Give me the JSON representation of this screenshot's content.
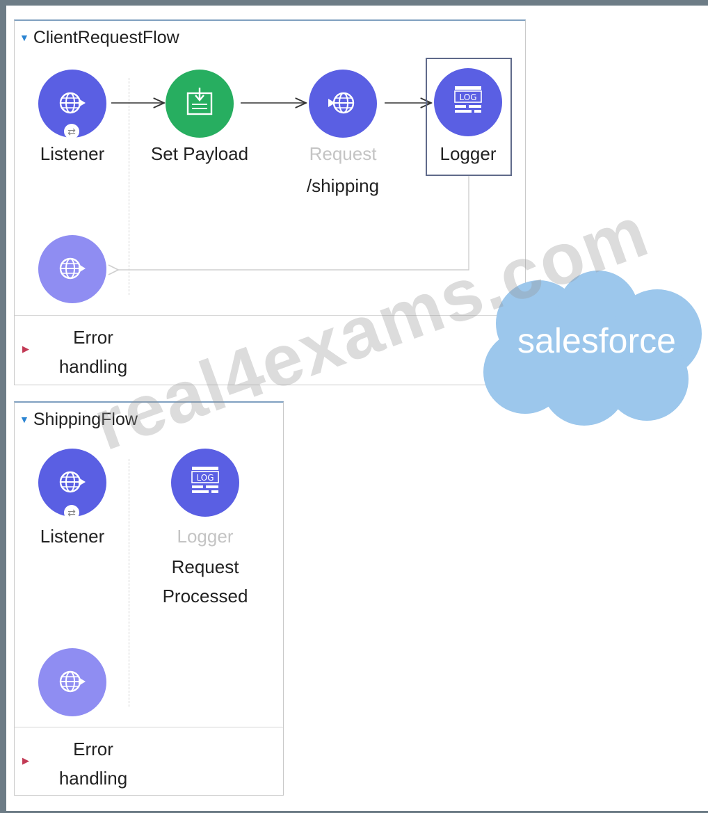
{
  "flows": [
    {
      "title": "ClientRequestFlow",
      "nodes": [
        {
          "label": "Listener",
          "icon": "globe-icon"
        },
        {
          "label": "Set Payload",
          "icon": "set-payload-icon"
        },
        {
          "label": "Request",
          "sublabel": "/shipping",
          "icon": "globe-icon"
        },
        {
          "label": "Logger",
          "icon": "log-icon"
        }
      ],
      "error_label_1": "Error",
      "error_label_2": "handling"
    },
    {
      "title": "ShippingFlow",
      "nodes": [
        {
          "label": "Listener",
          "icon": "globe-icon"
        },
        {
          "label": "Logger",
          "sublabel_1": "Request",
          "sublabel_2": "Processed",
          "icon": "log-icon"
        }
      ],
      "error_label_1": "Error",
      "error_label_2": "handling"
    }
  ],
  "log_glyph": "LOG",
  "watermark": "real4exams.com",
  "brand": "salesforce",
  "colors": {
    "node_purple": "#5a5fe3",
    "node_green": "#27ae60",
    "node_light": "#8f8df2",
    "cloud": "#9cc7ec",
    "accent_caret": "#2a84d2",
    "error_caret": "#c23a55"
  }
}
